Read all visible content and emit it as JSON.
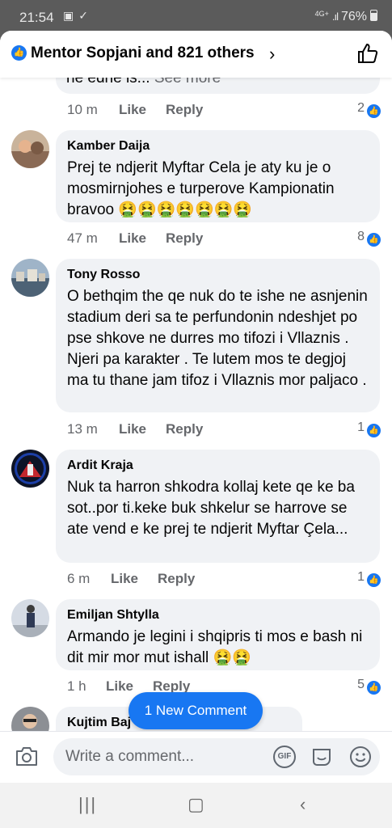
{
  "status": {
    "time": "21:54",
    "network": "4G+",
    "battery": "76%"
  },
  "header": {
    "reactions_text": "Mentor Sopjani and 821 others"
  },
  "previous_comment": {
    "tail_text": "ne edhe is...",
    "see_more": "See more",
    "time": "10 m",
    "like": "Like",
    "reply": "Reply",
    "like_count": "2"
  },
  "comments": [
    {
      "author": "Kamber Daija",
      "text": "Prej te ndjerit Myftar Cela je aty ku je o mosmirnjohes e turperove Kampionatin bravoo 🤮🤮🤮🤮🤮🤮🤮",
      "time": "47 m",
      "like": "Like",
      "reply": "Reply",
      "like_count": "8"
    },
    {
      "author": "Tony Rosso",
      "text": "O bethqim the qe nuk do te ishe ne asnjenin stadium deri sa te perfundonin ndeshjet po pse shkove ne durres mo tifozi i Vllaznis . Njeri pa karakter . Te lutem mos te degjoj ma tu thane jam tifoz i Vllaznis mor paljaco .",
      "time": "13 m",
      "like": "Like",
      "reply": "Reply",
      "like_count": "1"
    },
    {
      "author": "Ardit Kraja",
      "text": "Nuk ta harron shkodra kollaj kete qe ke ba sot..por ti.keke buk shkelur se harrove se ate vend e ke prej te ndjerit Myftar Çela...",
      "time": "6 m",
      "like": "Like",
      "reply": "Reply",
      "like_count": "1"
    },
    {
      "author": "Emiljan Shtylla",
      "text": "Armando je legini i shqipris ti mos e bash ni dit mir mor mut ishall 🤮🤮",
      "time": "1 h",
      "like": "Like",
      "reply": "Reply",
      "like_count": "5"
    },
    {
      "author": "Kujtim Baj",
      "text": ""
    }
  ],
  "new_comment_pill": "1 New Comment",
  "composer": {
    "placeholder": "Write a comment...",
    "gif_label": "GIF"
  },
  "colors": {
    "accent": "#1877f2",
    "bubble": "#f0f2f5",
    "meta": "#65676b"
  }
}
